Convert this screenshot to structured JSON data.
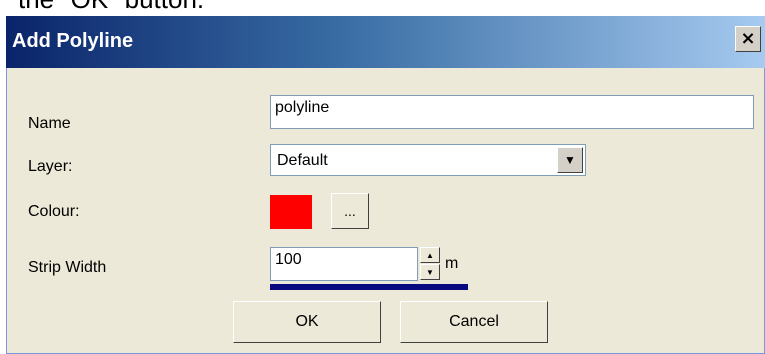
{
  "caption": {
    "text": "the \"OK\" button."
  },
  "dialog": {
    "title": "Add Polyline",
    "close_label": "×"
  },
  "form": {
    "name": {
      "label": "Name",
      "value": "polyline"
    },
    "layer": {
      "label": "Layer:",
      "value": "Default",
      "arrow": "▼"
    },
    "colour": {
      "label": "Colour:",
      "swatch_color": "#ff0000",
      "button_label": "..."
    },
    "strip_width": {
      "label": "Strip Width",
      "value": "100",
      "unit": "m",
      "up": "▲",
      "down": "▼"
    }
  },
  "buttons": {
    "ok": "OK",
    "cancel": "Cancel"
  }
}
